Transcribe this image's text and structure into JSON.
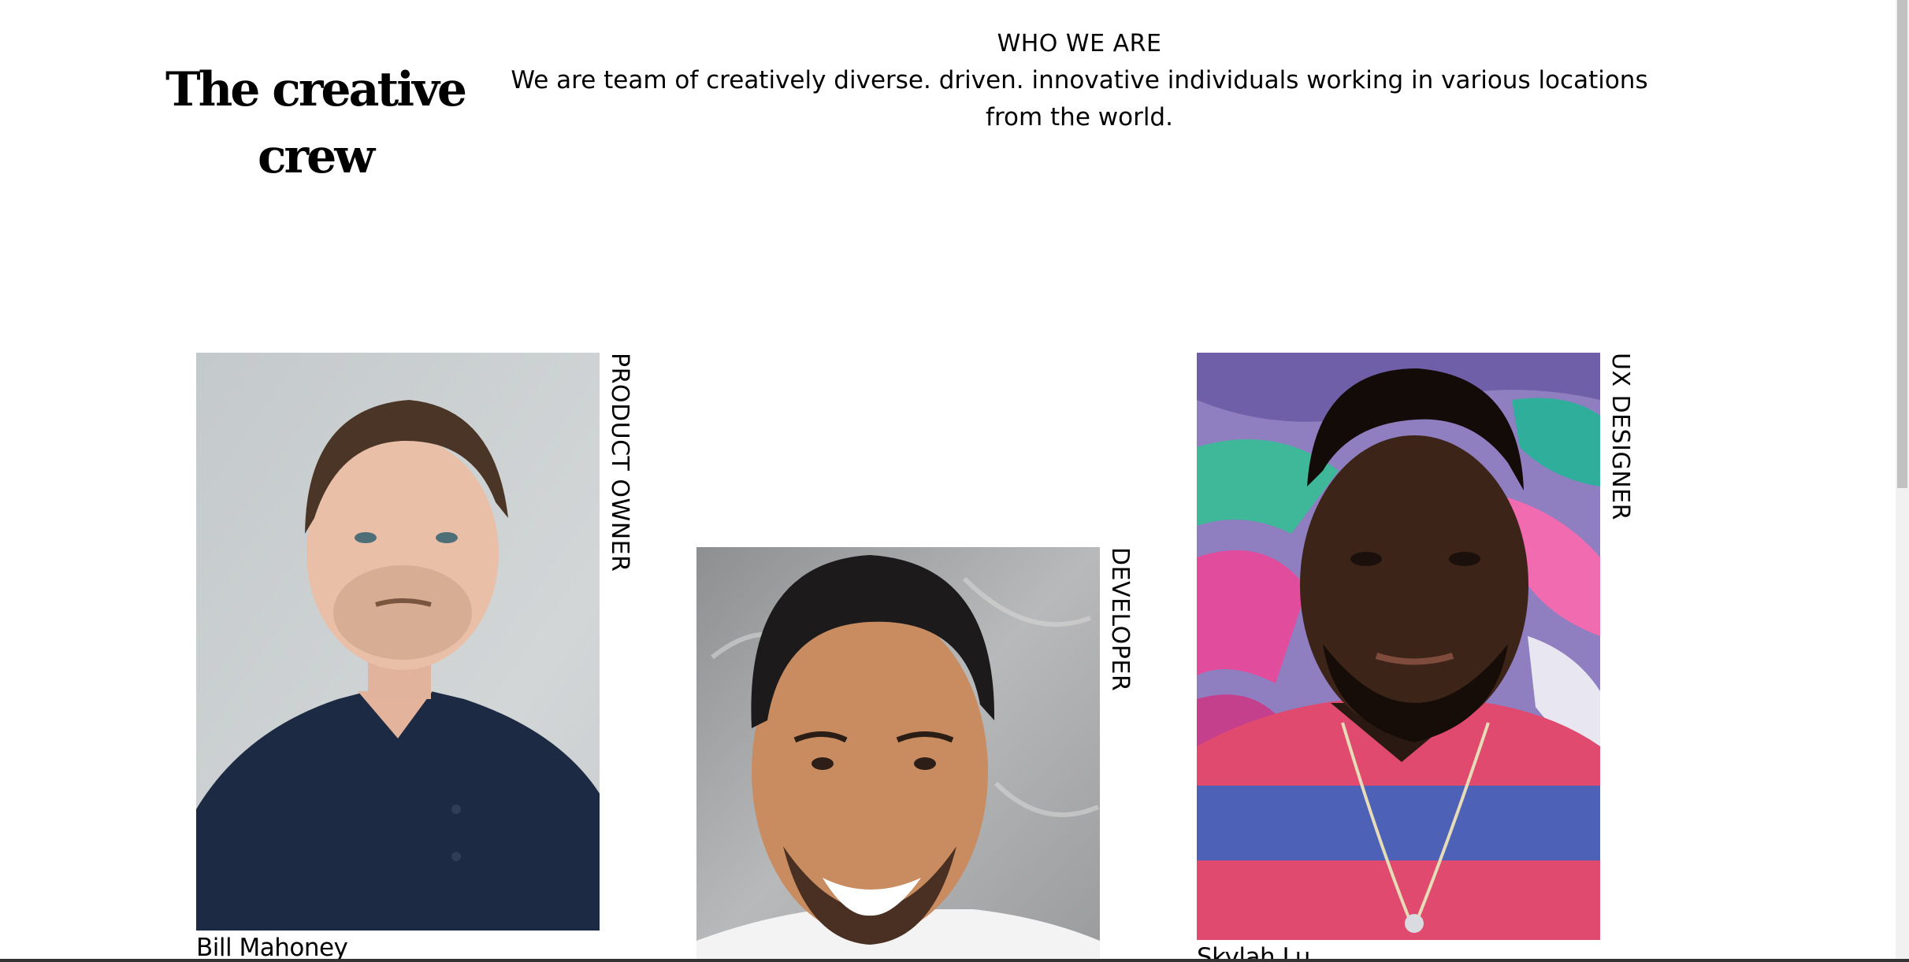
{
  "header": {
    "title": "The creative crew",
    "who_heading": "WHO WE ARE",
    "who_text": "We are team of creatively diverse. driven. innovative individuals working in various locations from the world."
  },
  "team": [
    {
      "name": "Bill Mahoney",
      "role": "PRODUCT OWNER"
    },
    {
      "name": "",
      "role": "DEVELOPER"
    },
    {
      "name": "Skylah Lu",
      "role": "UX DESIGNER"
    }
  ],
  "colors": {
    "background": "#ffffff",
    "text": "#000000"
  }
}
